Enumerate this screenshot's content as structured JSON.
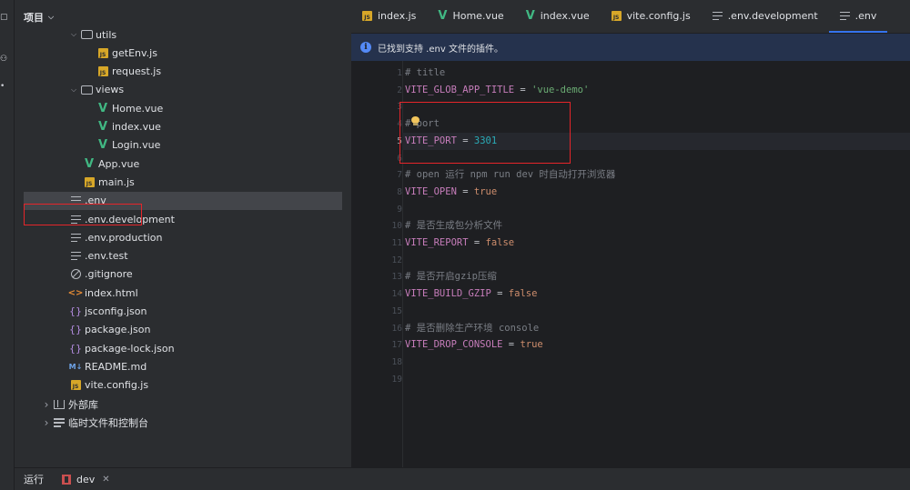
{
  "project": {
    "title": "项目",
    "tree": [
      {
        "label": "utils",
        "icon": "folder-icon",
        "type": "folder",
        "indent": 3,
        "expanded": true
      },
      {
        "label": "getEnv.js",
        "icon": "js-file-icon",
        "type": "js",
        "indent": 5
      },
      {
        "label": "request.js",
        "icon": "js-file-icon",
        "type": "js",
        "indent": 5
      },
      {
        "label": "views",
        "icon": "folder-icon",
        "type": "folder",
        "indent": 3,
        "expanded": true
      },
      {
        "label": "Home.vue",
        "icon": "vue-file-icon",
        "type": "vue",
        "indent": 5
      },
      {
        "label": "index.vue",
        "icon": "vue-file-icon",
        "type": "vue",
        "indent": 5
      },
      {
        "label": "Login.vue",
        "icon": "vue-file-icon",
        "type": "vue",
        "indent": 5
      },
      {
        "label": "App.vue",
        "icon": "vue-file-icon",
        "type": "vue",
        "indent": 4
      },
      {
        "label": "main.js",
        "icon": "js-file-icon",
        "type": "js",
        "indent": 4
      },
      {
        "label": ".env",
        "icon": "text-file-icon",
        "type": "text",
        "indent": 3,
        "selected": true
      },
      {
        "label": ".env.development",
        "icon": "text-file-icon",
        "type": "text",
        "indent": 3
      },
      {
        "label": ".env.production",
        "icon": "text-file-icon",
        "type": "text",
        "indent": 3
      },
      {
        "label": ".env.test",
        "icon": "text-file-icon",
        "type": "text",
        "indent": 3
      },
      {
        "label": ".gitignore",
        "icon": "ignore-file-icon",
        "type": "ignore",
        "indent": 3
      },
      {
        "label": "index.html",
        "icon": "html-file-icon",
        "type": "html",
        "indent": 3
      },
      {
        "label": "jsconfig.json",
        "icon": "json-file-icon",
        "type": "json",
        "indent": 3
      },
      {
        "label": "package.json",
        "icon": "json-file-icon",
        "type": "json",
        "indent": 3
      },
      {
        "label": "package-lock.json",
        "icon": "json-file-icon",
        "type": "json",
        "indent": 3
      },
      {
        "label": "README.md",
        "icon": "markdown-file-icon",
        "type": "md",
        "indent": 3
      },
      {
        "label": "vite.config.js",
        "icon": "js-file-icon",
        "type": "js",
        "indent": 3
      },
      {
        "label": "外部库",
        "icon": "library-icon",
        "type": "lib",
        "indent": 1,
        "collapsed": true
      },
      {
        "label": "临时文件和控制台",
        "icon": "console-icon",
        "type": "console",
        "indent": 1,
        "collapsed": true
      }
    ]
  },
  "tabs": [
    {
      "label": "index.js",
      "icon": "js-file-icon",
      "type": "js"
    },
    {
      "label": "Home.vue",
      "icon": "vue-file-icon",
      "type": "vue"
    },
    {
      "label": "index.vue",
      "icon": "vue-file-icon",
      "type": "vue"
    },
    {
      "label": "vite.config.js",
      "icon": "js-file-icon",
      "type": "js"
    },
    {
      "label": ".env.development",
      "icon": "text-file-icon",
      "type": "text"
    },
    {
      "label": ".env",
      "icon": "text-file-icon",
      "type": "text",
      "active": true
    }
  ],
  "banner": {
    "text": "已找到支持 .env 文件的插件。"
  },
  "editor": {
    "current_line": 5,
    "lines": [
      {
        "n": "1",
        "parts": [
          {
            "c": "cm",
            "t": "# title"
          }
        ]
      },
      {
        "n": "2",
        "parts": [
          {
            "c": "key",
            "t": "VITE_GLOB_APP_TITLE"
          },
          {
            "c": "op",
            "t": " = "
          },
          {
            "c": "str",
            "t": "'vue-demo'"
          }
        ]
      },
      {
        "n": "3",
        "parts": []
      },
      {
        "n": "4",
        "parts": [
          {
            "c": "cm",
            "t": "# port"
          }
        ]
      },
      {
        "n": "5",
        "parts": [
          {
            "c": "key",
            "t": "VITE_PORT"
          },
          {
            "c": "op",
            "t": " = "
          },
          {
            "c": "num",
            "t": "3301"
          }
        ]
      },
      {
        "n": "6",
        "parts": []
      },
      {
        "n": "7",
        "parts": [
          {
            "c": "cm",
            "t": "# open 运行 npm run dev 时自动打开浏览器"
          }
        ]
      },
      {
        "n": "8",
        "parts": [
          {
            "c": "key",
            "t": "VITE_OPEN"
          },
          {
            "c": "op",
            "t": " = "
          },
          {
            "c": "kw",
            "t": "true"
          }
        ]
      },
      {
        "n": "9",
        "parts": []
      },
      {
        "n": "10",
        "parts": [
          {
            "c": "cm",
            "t": "# 是否生成包分析文件"
          }
        ]
      },
      {
        "n": "11",
        "parts": [
          {
            "c": "key",
            "t": "VITE_REPORT"
          },
          {
            "c": "op",
            "t": " = "
          },
          {
            "c": "kw",
            "t": "false"
          }
        ]
      },
      {
        "n": "12",
        "parts": []
      },
      {
        "n": "13",
        "parts": [
          {
            "c": "cm",
            "t": "# 是否开启gzip压缩"
          }
        ]
      },
      {
        "n": "14",
        "parts": [
          {
            "c": "key",
            "t": "VITE_BUILD_GZIP"
          },
          {
            "c": "op",
            "t": " = "
          },
          {
            "c": "kw",
            "t": "false"
          }
        ]
      },
      {
        "n": "15",
        "parts": []
      },
      {
        "n": "16",
        "parts": [
          {
            "c": "cm",
            "t": "# 是否删除生产环境 console"
          }
        ]
      },
      {
        "n": "17",
        "parts": [
          {
            "c": "key",
            "t": "VITE_DROP_CONSOLE"
          },
          {
            "c": "op",
            "t": " = "
          },
          {
            "c": "kw",
            "t": "true"
          }
        ]
      },
      {
        "n": "18",
        "parts": []
      },
      {
        "n": "19",
        "parts": []
      }
    ]
  },
  "bottom": {
    "run_label": "运行",
    "run_config": "dev"
  },
  "colors": {
    "accent": "#3574f0",
    "highlight_box": "#e5252a",
    "banner_bg": "#25324d"
  }
}
